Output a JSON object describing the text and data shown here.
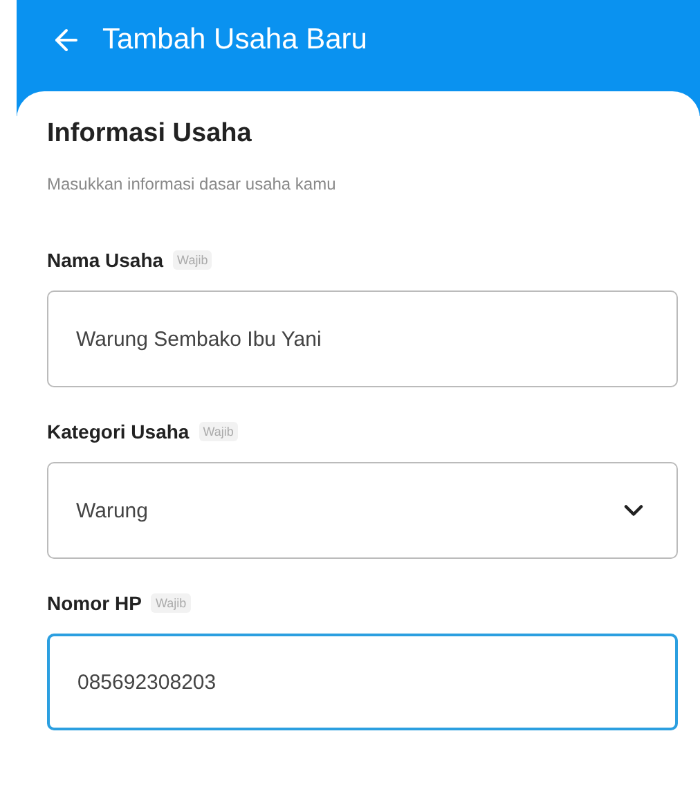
{
  "header": {
    "title": "Tambah Usaha Baru"
  },
  "section": {
    "title": "Informasi Usaha",
    "subtitle": "Masukkan informasi dasar usaha kamu"
  },
  "fields": [
    {
      "kind": "text",
      "label": "Nama Usaha",
      "badge": "Wajib",
      "value": "Warung Sembako Ibu Yani",
      "focused": false
    },
    {
      "kind": "select",
      "label": "Kategori Usaha",
      "badge": "Wajib",
      "value": "Warung",
      "focused": false
    },
    {
      "kind": "text",
      "label": "Nomor HP",
      "badge": "Wajib",
      "value": "085692308203",
      "focused": true
    }
  ]
}
